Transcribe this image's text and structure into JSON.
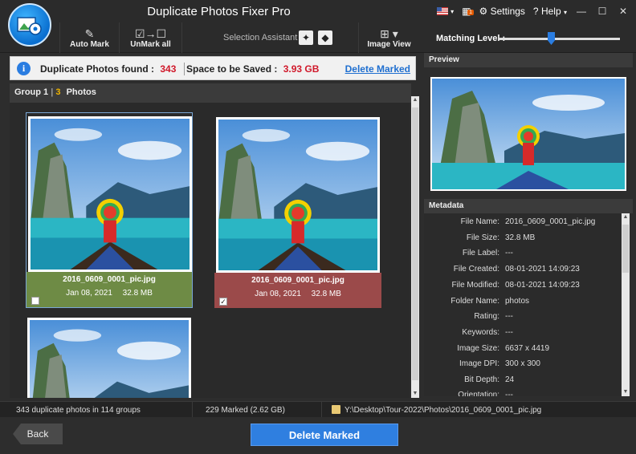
{
  "window": {
    "title": "Duplicate Photos Fixer Pro",
    "settings_label": "Settings",
    "help_label": "Help",
    "notification_count": "1"
  },
  "toolbar": {
    "auto_mark_label": "Auto Mark",
    "unmark_all_label": "UnMark all",
    "selection_assistant_label": "Selection Assistant",
    "image_view_label": "Image View",
    "matching_level_label": "Matching Level :"
  },
  "info": {
    "found_label": "Duplicate Photos found :",
    "found_value": "343",
    "space_label": "Space to be Saved :",
    "space_value": "3.93 GB",
    "delete_marked_link": "Delete Marked"
  },
  "group": {
    "label": "Group 1",
    "count": "3",
    "photos_label": "Photos"
  },
  "photos": [
    {
      "filename": "2016_0609_0001_pic.jpg",
      "date": "Jan 08, 2021",
      "size": "32.8 MB",
      "checked": false
    },
    {
      "filename": "2016_0609_0001_pic.jpg",
      "date": "Jan 08, 2021",
      "size": "32.8 MB",
      "checked": true
    }
  ],
  "preview": {
    "header": "Preview"
  },
  "metadata": {
    "header": "Metadata",
    "rows": [
      {
        "key": "File Name:",
        "value": "2016_0609_0001_pic.jpg"
      },
      {
        "key": "File Size:",
        "value": "32.8 MB"
      },
      {
        "key": "File Label:",
        "value": "---"
      },
      {
        "key": "File Created:",
        "value": "08-01-2021 14:09:23"
      },
      {
        "key": "File Modified:",
        "value": "08-01-2021 14:09:23"
      },
      {
        "key": "Folder Name:",
        "value": "photos"
      },
      {
        "key": "Rating:",
        "value": "---"
      },
      {
        "key": "Keywords:",
        "value": "---"
      },
      {
        "key": "Image Size:",
        "value": "6637 x 4419"
      },
      {
        "key": "Image DPI:",
        "value": "300 x 300"
      },
      {
        "key": "Bit Depth:",
        "value": "24"
      },
      {
        "key": "Orientation:",
        "value": "---"
      }
    ]
  },
  "status": {
    "groups_text": "343 duplicate photos in 114 groups",
    "marked_text": "229 Marked (2.62 GB)",
    "path_text": "Y:\\Desktop\\Tour-2022\\Photos\\2016_0609_0001_pic.jpg"
  },
  "buttons": {
    "back_label": "Back",
    "delete_marked_label": "Delete Marked"
  },
  "colors": {
    "accent": "#2f7fe0",
    "unmarked_footer": "#6e8b45",
    "marked_footer": "#9b4a4a",
    "highlight_red": "#d0182a"
  }
}
